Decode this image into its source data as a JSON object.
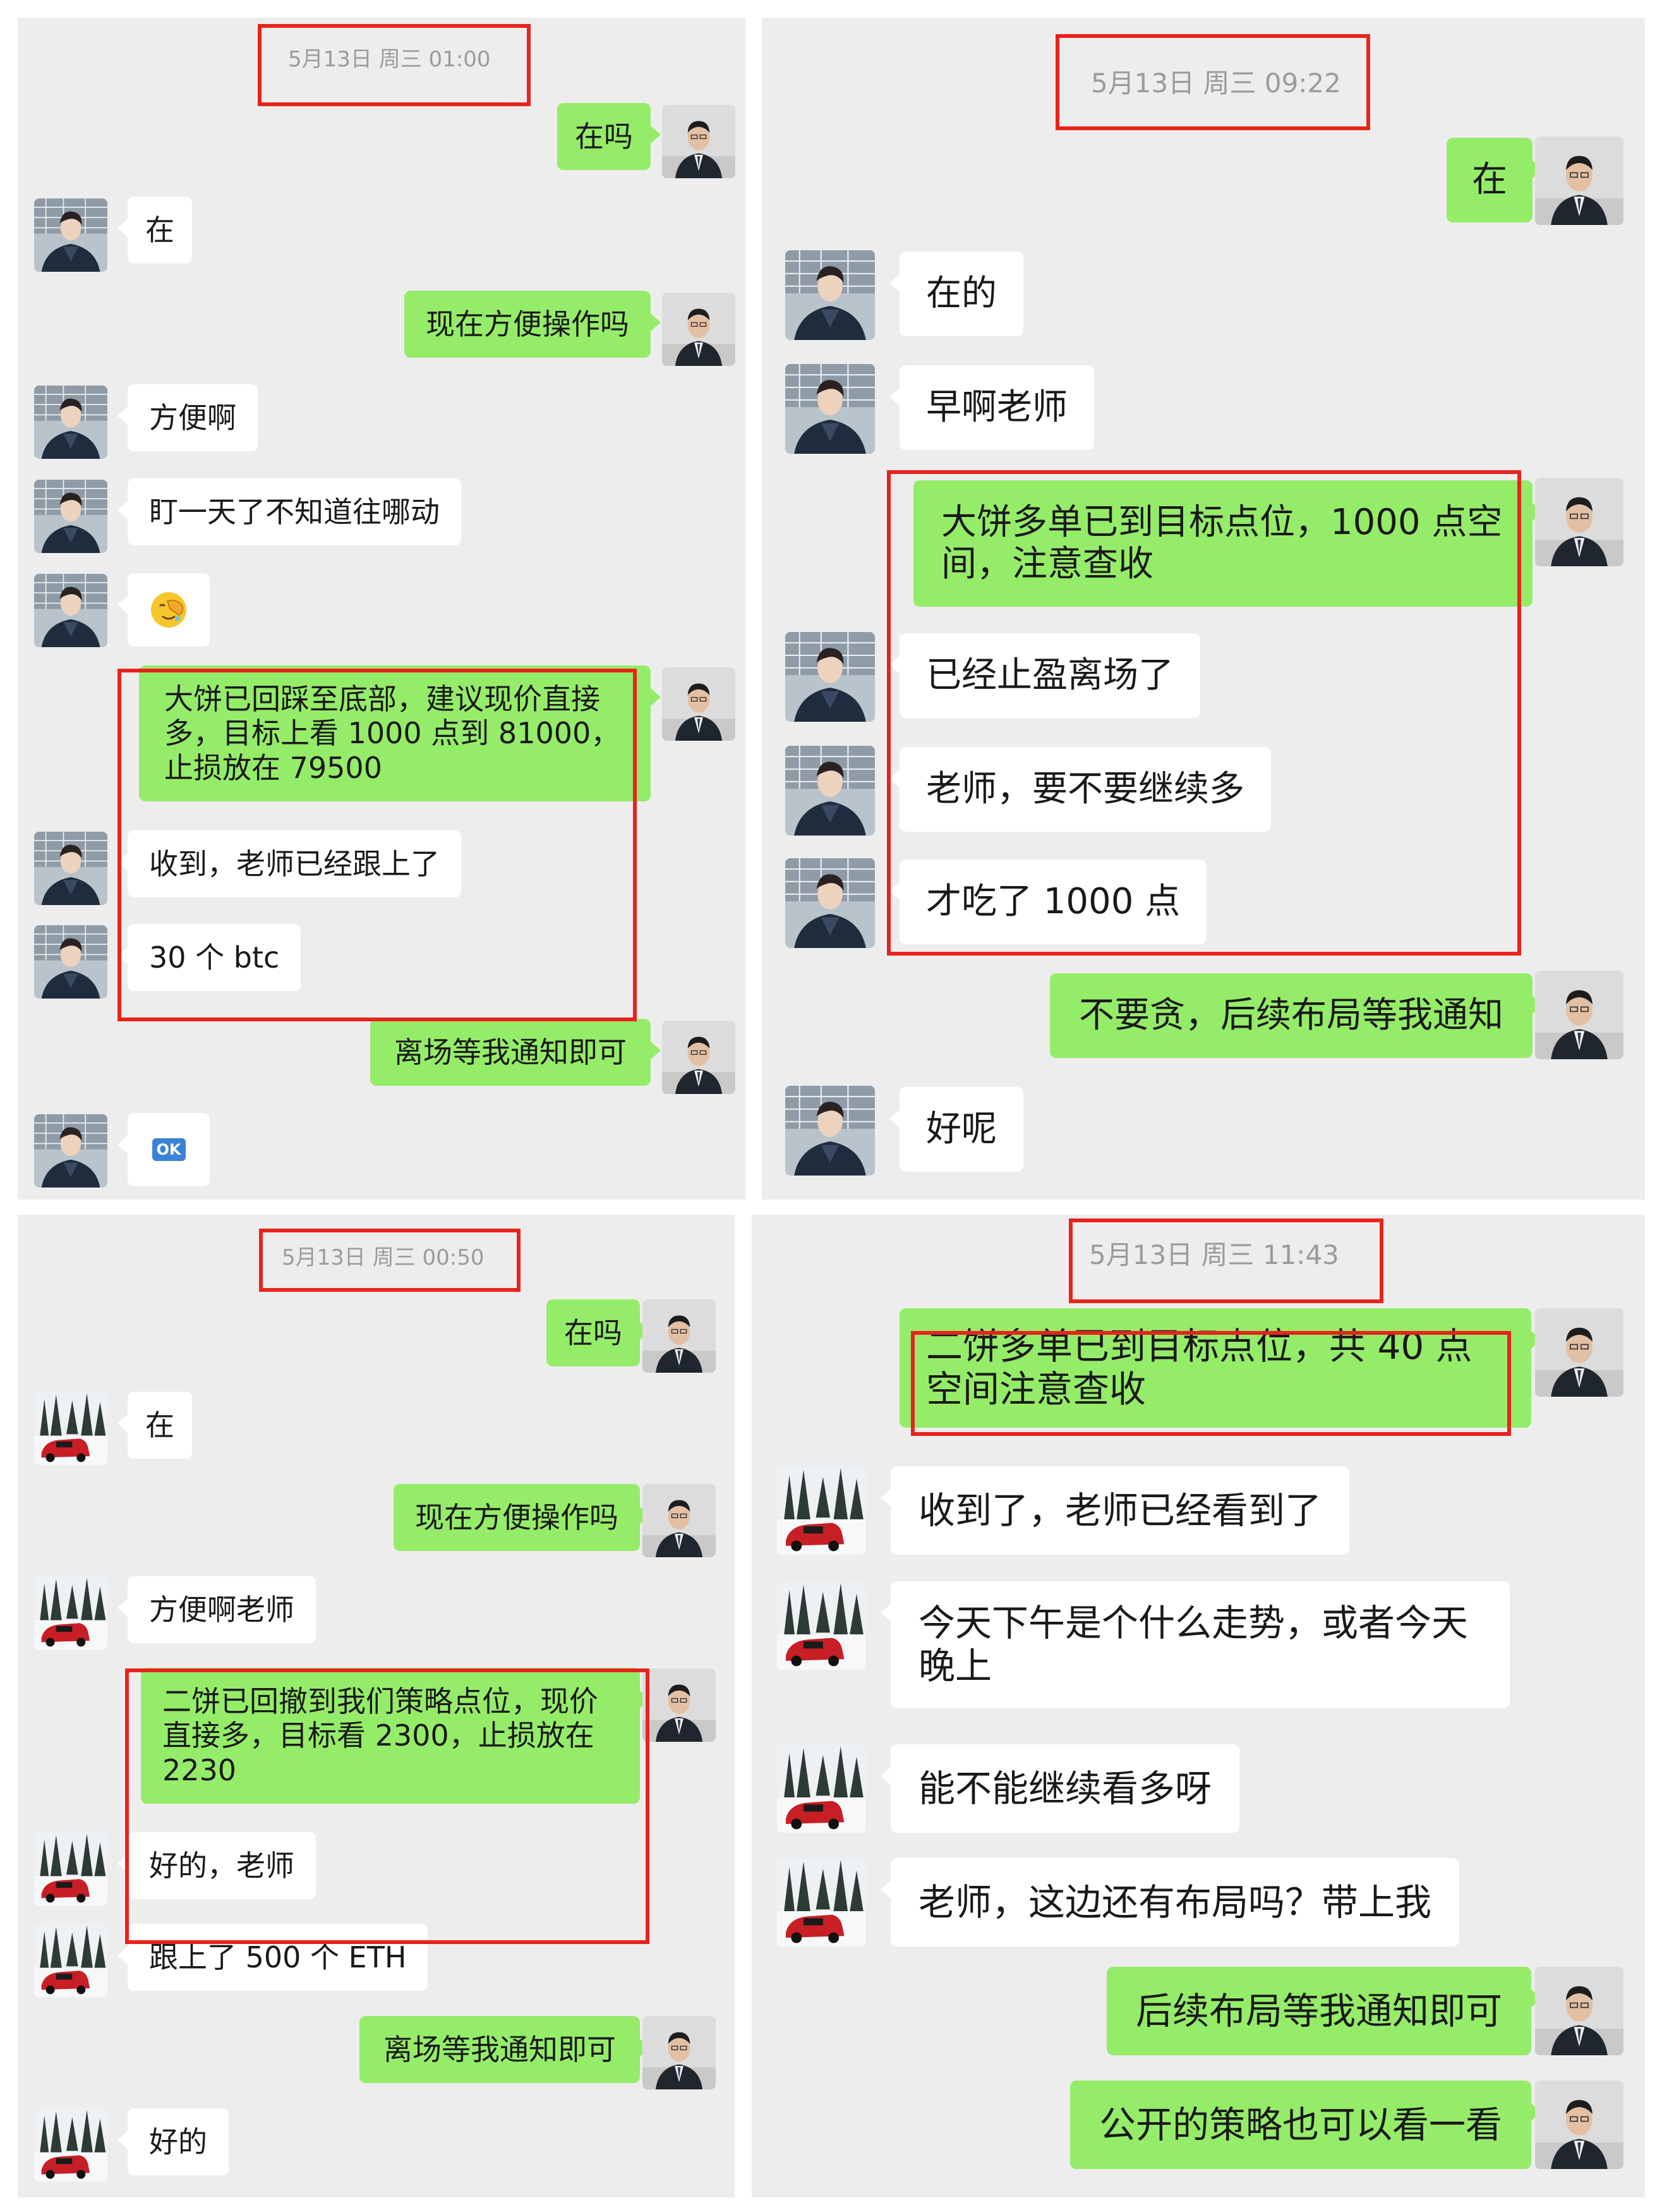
{
  "panels": [
    {
      "timestamp": "5月13日 周三 01:00",
      "messages": [
        {
          "side": "out",
          "text": "在吗"
        },
        {
          "side": "in",
          "text": "在"
        },
        {
          "side": "out",
          "text": "现在方便操作吗"
        },
        {
          "side": "in",
          "text": "方便啊"
        },
        {
          "side": "in",
          "text": "盯一天了不知道往哪动"
        },
        {
          "side": "in",
          "text": "🤦"
        },
        {
          "side": "out",
          "text": "大饼已回踩至底部，建议现价直接多，目标上看 1000 点到 81000，止损放在 79500"
        },
        {
          "side": "in",
          "text": "收到，老师已经跟上了"
        },
        {
          "side": "in",
          "text": "30 个 btc"
        },
        {
          "side": "out",
          "text": "离场等我通知即可"
        },
        {
          "side": "in",
          "text": "OK"
        }
      ]
    },
    {
      "timestamp": "5月13日 周三 09:22",
      "messages": [
        {
          "side": "out",
          "text": "在"
        },
        {
          "side": "in",
          "text": "在的"
        },
        {
          "side": "in",
          "text": "早啊老师"
        },
        {
          "side": "out",
          "text": "大饼多单已到目标点位，1000 点空间，注意查收"
        },
        {
          "side": "in",
          "text": "已经止盈离场了"
        },
        {
          "side": "in",
          "text": "老师，要不要继续多"
        },
        {
          "side": "in",
          "text": "才吃了 1000 点"
        },
        {
          "side": "out",
          "text": "不要贪，后续布局等我通知"
        },
        {
          "side": "in",
          "text": "好呢"
        }
      ]
    },
    {
      "timestamp": "5月13日 周三 00:50",
      "messages": [
        {
          "side": "out",
          "text": "在吗"
        },
        {
          "side": "in",
          "text": "在"
        },
        {
          "side": "out",
          "text": "现在方便操作吗"
        },
        {
          "side": "in",
          "text": "方便啊老师"
        },
        {
          "side": "out",
          "text": "二饼已回撤到我们策略点位，现价直接多，目标看 2300，止损放在 2230"
        },
        {
          "side": "in",
          "text": "好的，老师"
        },
        {
          "side": "in",
          "text": "跟上了 500 个 ETH"
        },
        {
          "side": "out",
          "text": "离场等我通知即可"
        },
        {
          "side": "in",
          "text": "好的"
        }
      ]
    },
    {
      "timestamp": "5月13日 周三 11:43",
      "messages": [
        {
          "side": "out",
          "text": "二饼多单已到目标点位，共 40 点空间注意查收"
        },
        {
          "side": "in",
          "text": "收到了，老师已经看到了"
        },
        {
          "side": "in",
          "text": "今天下午是个什么走势，或者今天晚上"
        },
        {
          "side": "in",
          "text": "能不能继续看多呀"
        },
        {
          "side": "in",
          "text": "老师，这边还有布局吗？带上我"
        },
        {
          "side": "out",
          "text": "后续布局等我通知即可"
        },
        {
          "side": "out",
          "text": "公开的策略也可以看一看"
        }
      ]
    }
  ],
  "colors": {
    "panel_bg": "#ededed",
    "bubble_out": "#95ec69",
    "bubble_in": "#ffffff",
    "highlight": "#e8231c"
  }
}
